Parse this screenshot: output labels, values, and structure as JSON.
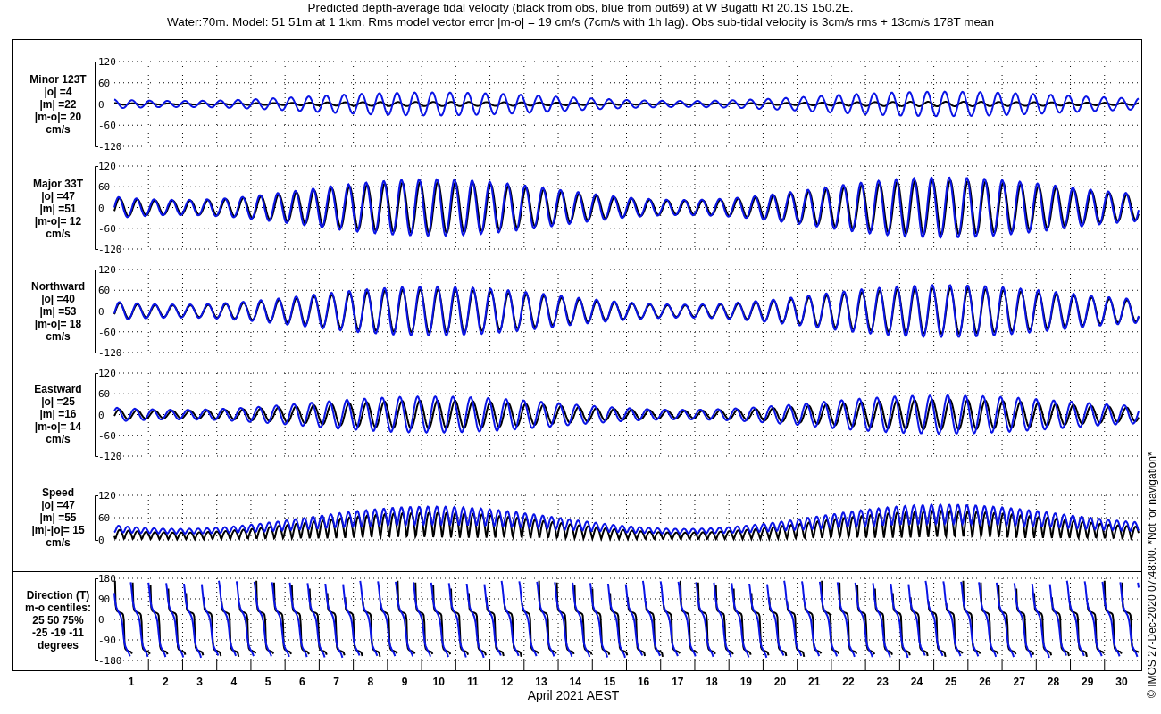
{
  "title_lines": [
    "Predicted depth-average tidal velocity (black from obs, blue from out69) at W Bugatti Rf 20.1S 150.2E.",
    "Water:70m. Model: 51 51m at 1 1km. Rms model vector error |m-o| = 19 cm/s (7cm/s with 1h lag). Obs sub-tidal velocity is 3cm/s rms + 13cm/s 178T mean"
  ],
  "panels": [
    {
      "kind": "minor",
      "label_lines": [
        "Minor 123T",
        "|o| =4",
        "|m| =22",
        "|m-o|= 20",
        "cm/s"
      ],
      "yticks": [
        "120",
        "60",
        "0",
        "-60",
        "-120"
      ]
    },
    {
      "kind": "major",
      "label_lines": [
        "Major 33T",
        "|o| =47",
        "|m| =51",
        "|m-o|= 12",
        "cm/s"
      ],
      "yticks": [
        "120",
        "60",
        "0",
        "-60",
        "-120"
      ]
    },
    {
      "kind": "northward",
      "label_lines": [
        "Northward",
        "|o| =40",
        "|m| =53",
        "|m-o|= 18",
        "cm/s"
      ],
      "yticks": [
        "120",
        "60",
        "0",
        "-60",
        "-120"
      ]
    },
    {
      "kind": "eastward",
      "label_lines": [
        "Eastward",
        "|o| =25",
        "|m| =16",
        "|m-o|= 14",
        "cm/s"
      ],
      "yticks": [
        "120",
        "60",
        "0",
        "-60",
        "-120"
      ]
    },
    {
      "kind": "speed",
      "label_lines": [
        "Speed",
        "|o| =47",
        "|m| =55",
        "|m|-|o|= 15",
        "cm/s"
      ],
      "yticks": [
        "120",
        "60",
        "0"
      ]
    },
    {
      "kind": "direction",
      "label_lines": [
        "Direction (T)",
        "m-o centiles:",
        "25  50  75%",
        "-25 -19 -11",
        "degrees"
      ],
      "yticks": [
        "180",
        "90",
        "0",
        "-90",
        "-180"
      ]
    }
  ],
  "x_axis": {
    "labels": [
      "1",
      "2",
      "3",
      "4",
      "5",
      "6",
      "7",
      "8",
      "9",
      "10",
      "11",
      "12",
      "13",
      "14",
      "15",
      "16",
      "17",
      "18",
      "19",
      "20",
      "21",
      "22",
      "23",
      "24",
      "25",
      "26",
      "27",
      "28",
      "29",
      "30"
    ],
    "title": "April 2021 AEST"
  },
  "credit": "© IMOS 27-Dec-2020 07:48:00.  *Not for navigation*"
}
